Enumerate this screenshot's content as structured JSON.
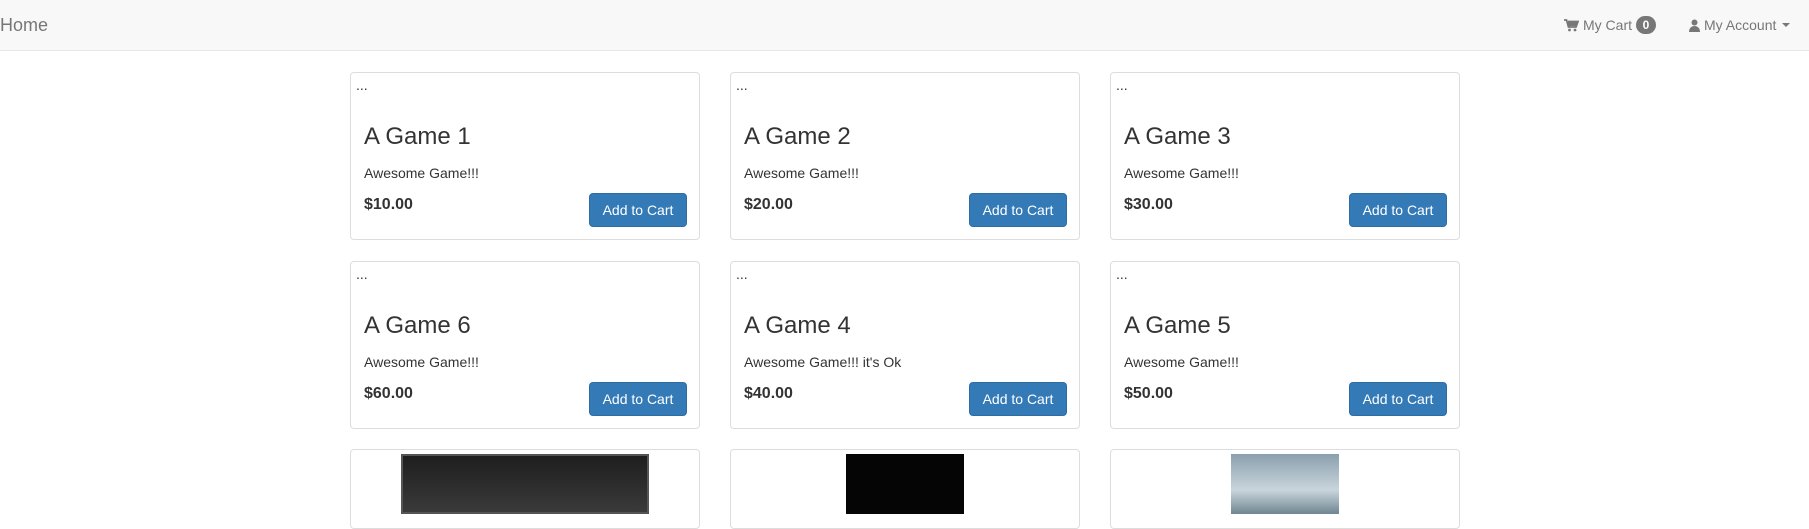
{
  "navbar": {
    "brand": "Home",
    "cart_label": "My Cart",
    "cart_count": "0",
    "account_label": "My Account"
  },
  "products": [
    {
      "thumb": "...",
      "title": "A Game 1",
      "description": "Awesome Game!!!",
      "price": "$10.00",
      "button": "Add to Cart"
    },
    {
      "thumb": "...",
      "title": "A Game 2",
      "description": "Awesome Game!!!",
      "price": "$20.00",
      "button": "Add to Cart"
    },
    {
      "thumb": "...",
      "title": "A Game 3",
      "description": "Awesome Game!!!",
      "price": "$30.00",
      "button": "Add to Cart"
    },
    {
      "thumb": "...",
      "title": "A Game 6",
      "description": "Awesome Game!!!",
      "price": "$60.00",
      "button": "Add to Cart"
    },
    {
      "thumb": "...",
      "title": "A Game 4",
      "description": "Awesome Game!!! it's Ok",
      "price": "$40.00",
      "button": "Add to Cart"
    },
    {
      "thumb": "...",
      "title": "A Game 5",
      "description": "Awesome Game!!!",
      "price": "$50.00",
      "button": "Add to Cart"
    }
  ],
  "icons": {
    "cart": "shopping-cart-icon",
    "account": "user-icon",
    "caret": "chevron-down-icon"
  },
  "colors": {
    "primary_button": "#337ab7",
    "navbar_bg": "#f8f8f8",
    "badge_bg": "#777777"
  }
}
